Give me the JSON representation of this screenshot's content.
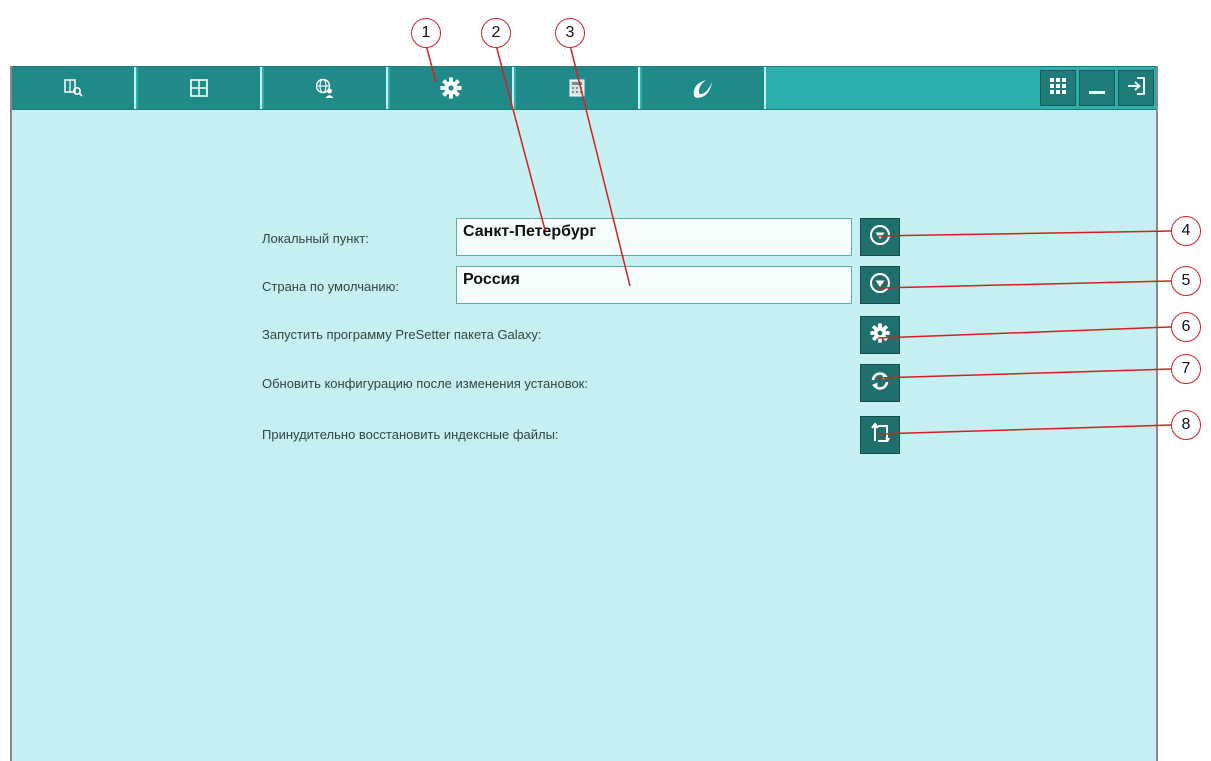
{
  "toolbar": {
    "tabs": [
      {
        "icon": "book-search-icon"
      },
      {
        "icon": "grid-table-icon"
      },
      {
        "icon": "globe-user-icon"
      },
      {
        "icon": "gear-icon"
      },
      {
        "icon": "calculator-icon"
      },
      {
        "icon": "galaxy-logo-icon"
      }
    ],
    "window_buttons": [
      {
        "icon": "apps-grid-icon"
      },
      {
        "icon": "minimize-icon"
      },
      {
        "icon": "exit-icon"
      }
    ]
  },
  "form": {
    "local_point_label": "Локальный пункт:",
    "local_point_value": "Санкт-Петербург",
    "default_country_label": "Страна по умолчанию:",
    "default_country_value": "Россия",
    "presetter_label": "Запустить программу PreSetter пакета Galaxy:",
    "refresh_label": "Обновить конфигурацию после изменения установок:",
    "reindex_label": "Принудительно восстановить индексные файлы:"
  },
  "callouts": [
    "1",
    "2",
    "3",
    "4",
    "5",
    "6",
    "7",
    "8"
  ],
  "colors": {
    "toolbar": "#2bb0ad",
    "tab": "#1f8a87",
    "panel": "#c5eff0",
    "action_button": "#1f6f6d",
    "callout": "#d32020"
  }
}
